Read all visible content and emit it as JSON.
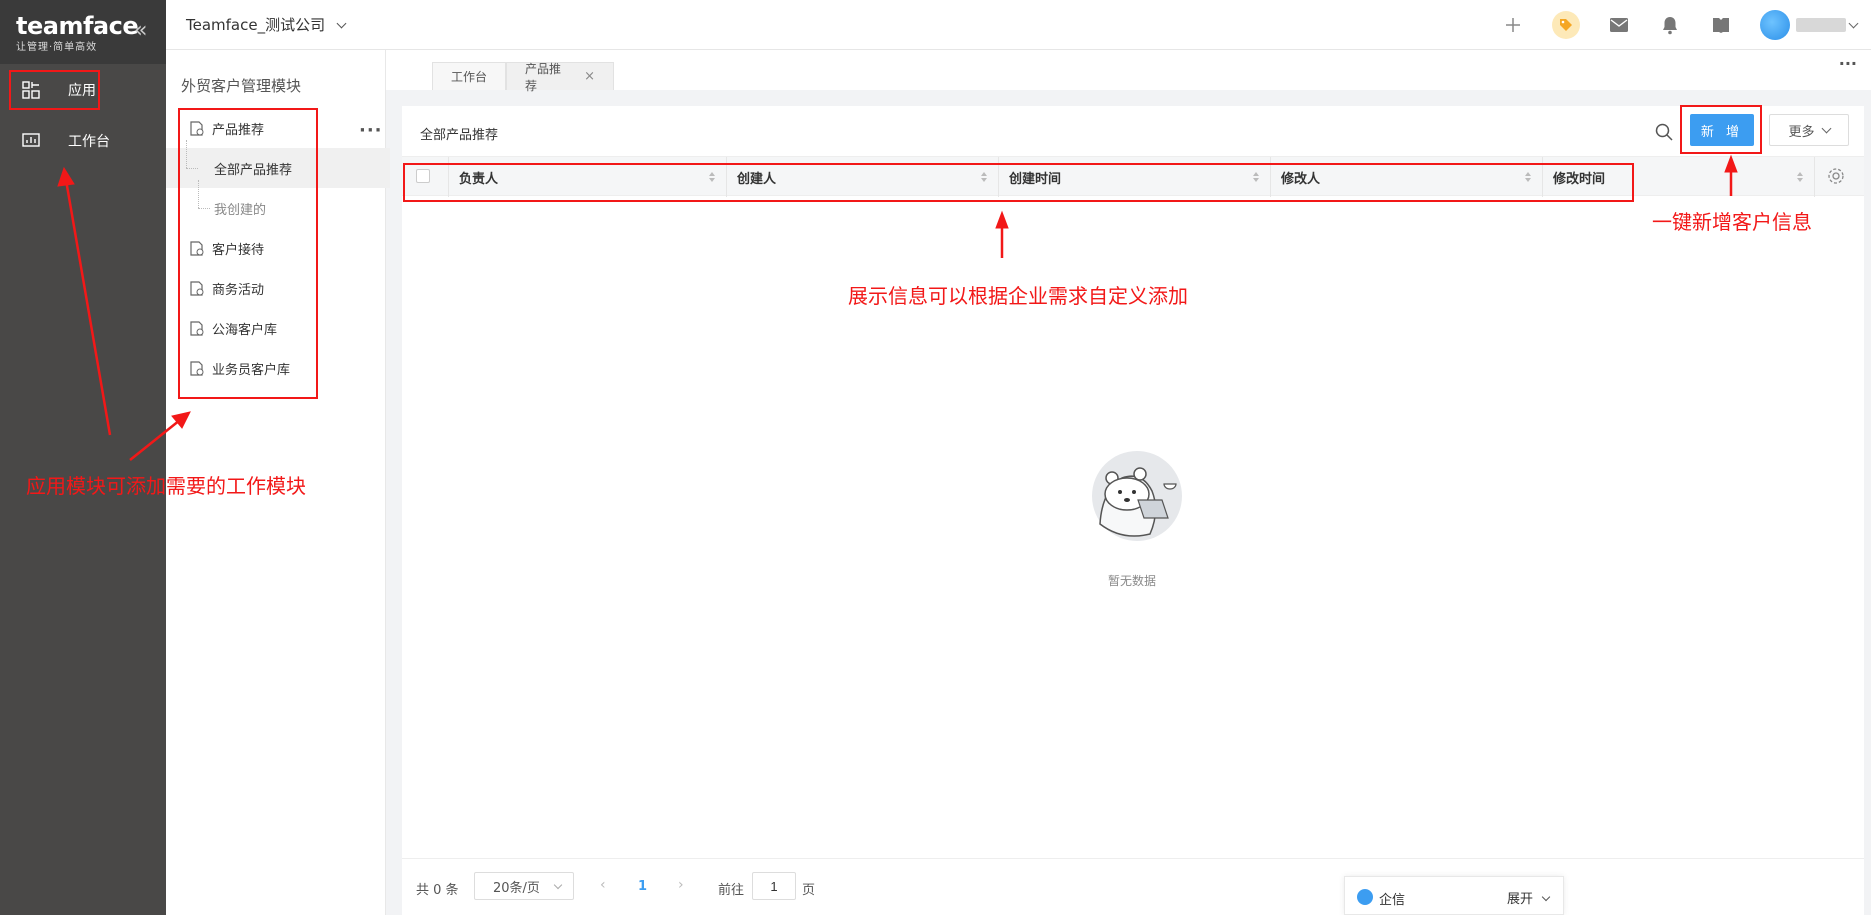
{
  "brand": {
    "logo": "teamface",
    "slogan": "让管理·简单高效"
  },
  "nav": {
    "items": [
      {
        "label": "应用"
      },
      {
        "label": "工作台"
      }
    ]
  },
  "topbar": {
    "company": "Teamface_测试公司"
  },
  "module": {
    "title": "外贸客户管理模块",
    "items": [
      {
        "label": "产品推荐"
      },
      {
        "label": "全部产品推荐"
      },
      {
        "label": "我创建的"
      },
      {
        "label": "客户接待"
      },
      {
        "label": "商务活动"
      },
      {
        "label": "公海客户库"
      },
      {
        "label": "业务员客户库"
      }
    ]
  },
  "tabs": [
    {
      "label": "工作台"
    },
    {
      "label": "产品推荐"
    }
  ],
  "main": {
    "title": "全部产品推荐",
    "new_label": "新 增",
    "more_label": "更多",
    "columns": [
      "负责人",
      "创建人",
      "创建时间",
      "修改人",
      "修改时间"
    ],
    "empty_text": "暂无数据"
  },
  "footer": {
    "total": "共 0 条",
    "page_size": "20条/页",
    "current_page": "1",
    "goto_label": "前往",
    "goto_value": "1",
    "page_unit": "页"
  },
  "chat": {
    "label": "企信",
    "expand": "展开"
  },
  "annotations": {
    "left": "应用模块可添加需要的工作模块",
    "center": "展示信息可以根据企业需求自定义添加",
    "right": "一键新增客户信息"
  },
  "colors": {
    "annotation": "#f21818",
    "primary": "#3c9df1",
    "sidebar": "#494847"
  }
}
